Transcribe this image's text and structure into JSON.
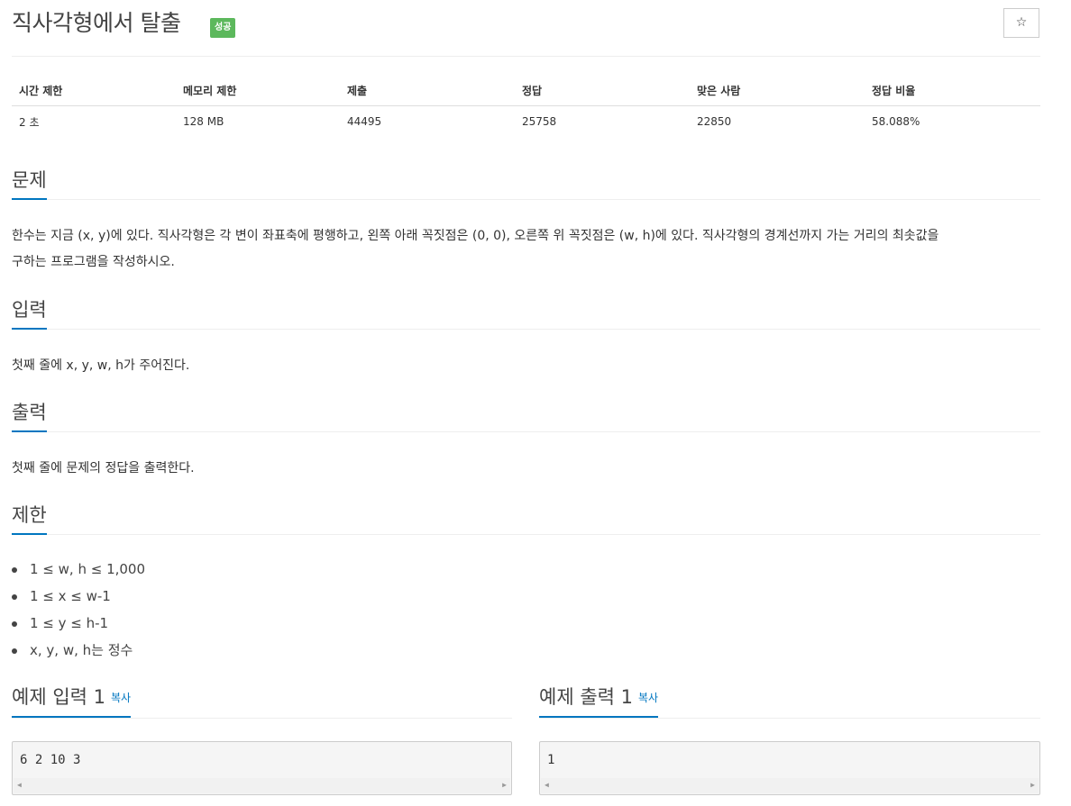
{
  "header": {
    "title": "직사각형에서 탈출",
    "badge": "성공",
    "star": "☆"
  },
  "info_table": {
    "headers": [
      "시간 제한",
      "메모리 제한",
      "제출",
      "정답",
      "맞은 사람",
      "정답 비율"
    ],
    "values": [
      "2 초",
      "128 MB",
      "44495",
      "25758",
      "22850",
      "58.088%"
    ]
  },
  "sections": {
    "problem": {
      "heading": "문제",
      "lines": [
        "한수는 지금 (x, y)에 있다. 직사각형은 각 변이 좌표축에 평행하고, 왼쪽 아래 꼭짓점은 (0, 0), 오른쪽 위 꼭짓점은 (w, h)에 있다. 직사각형의 경계선까지 가는 거리의 최솟값을",
        "구하는 프로그램을 작성하시오."
      ]
    },
    "input": {
      "heading": "입력",
      "text": "첫째 줄에 x, y, w, h가 주어진다."
    },
    "output": {
      "heading": "출력",
      "text": "첫째 줄에 문제의 정답을 출력한다."
    },
    "limits": {
      "heading": "제한",
      "items": [
        "1 ≤ w, h ≤ 1,000",
        "1 ≤ x ≤ w-1",
        "1 ≤ y ≤ h-1",
        "x, y, w, h는 정수"
      ]
    }
  },
  "samples": {
    "input": {
      "heading": "예제 입력 1",
      "copy": "복사",
      "content": "6 2 10 3"
    },
    "output": {
      "heading": "예제 출력 1",
      "copy": "복사",
      "content": "1"
    }
  },
  "colors": {
    "accent": "#0076c0",
    "badge": "#5cb85c"
  }
}
